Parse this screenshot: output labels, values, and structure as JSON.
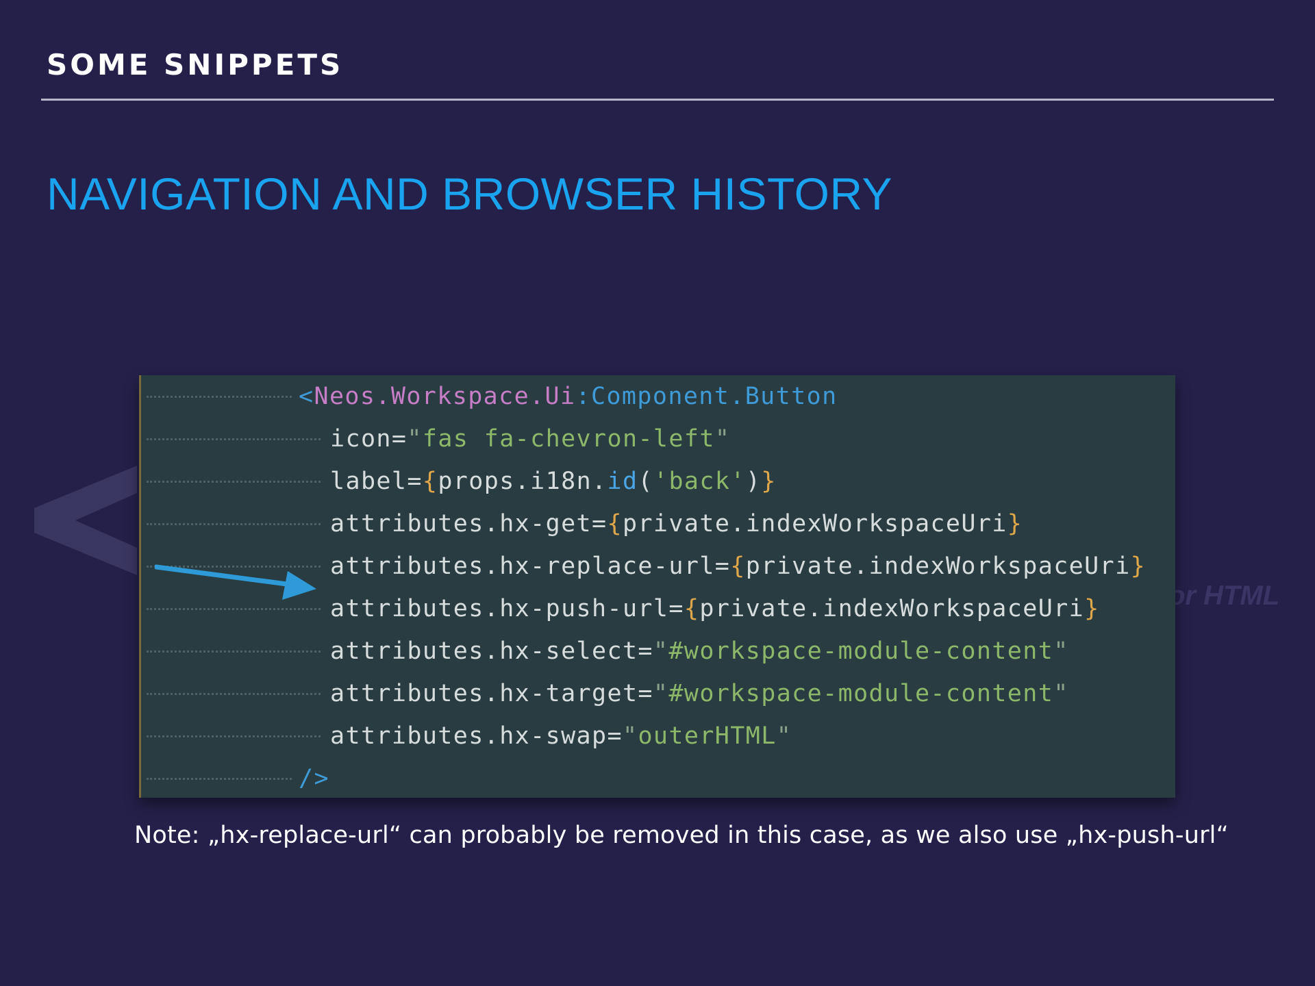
{
  "header": {
    "section_label": "SOME SNIPPETS",
    "title": "NAVIGATION AND BROWSER HISTORY"
  },
  "background": {
    "watermark_text": "or HTML"
  },
  "code": {
    "lines": [
      [
        {
          "t": "<",
          "c": "t-ns"
        },
        {
          "t": "Neos.Workspace.Ui",
          "c": "t-tag"
        },
        {
          "t": ":Component.Button",
          "c": "t-ns"
        }
      ],
      [
        {
          "t": "icon=",
          "c": "t-attr"
        },
        {
          "t": "\"",
          "c": "t-quote"
        },
        {
          "t": "fas fa-chevron-left",
          "c": "t-str"
        },
        {
          "t": "\"",
          "c": "t-quote"
        }
      ],
      [
        {
          "t": "label=",
          "c": "t-attr"
        },
        {
          "t": "{",
          "c": "t-brace"
        },
        {
          "t": "props.i18n.",
          "c": "t-attr"
        },
        {
          "t": "id",
          "c": "t-fn"
        },
        {
          "t": "(",
          "c": "t-punc"
        },
        {
          "t": "'back'",
          "c": "t-str"
        },
        {
          "t": ")",
          "c": "t-punc"
        },
        {
          "t": "}",
          "c": "t-brace"
        }
      ],
      [
        {
          "t": "attributes.hx-get=",
          "c": "t-attr"
        },
        {
          "t": "{",
          "c": "t-brace"
        },
        {
          "t": "private.indexWorkspaceUri",
          "c": "t-attr"
        },
        {
          "t": "}",
          "c": "t-brace"
        }
      ],
      [
        {
          "t": "attributes.hx-replace-url=",
          "c": "t-attr"
        },
        {
          "t": "{",
          "c": "t-brace"
        },
        {
          "t": "private.indexWorkspaceUri",
          "c": "t-attr"
        },
        {
          "t": "}",
          "c": "t-brace"
        }
      ],
      [
        {
          "t": "attributes.hx-push-url=",
          "c": "t-attr"
        },
        {
          "t": "{",
          "c": "t-brace"
        },
        {
          "t": "private.indexWorkspaceUri",
          "c": "t-attr"
        },
        {
          "t": "}",
          "c": "t-brace"
        }
      ],
      [
        {
          "t": "attributes.hx-select=",
          "c": "t-attr"
        },
        {
          "t": "\"",
          "c": "t-quote"
        },
        {
          "t": "#workspace-module-content",
          "c": "t-str"
        },
        {
          "t": "\"",
          "c": "t-quote"
        }
      ],
      [
        {
          "t": "attributes.hx-target=",
          "c": "t-attr"
        },
        {
          "t": "\"",
          "c": "t-quote"
        },
        {
          "t": "#workspace-module-content",
          "c": "t-str"
        },
        {
          "t": "\"",
          "c": "t-quote"
        }
      ],
      [
        {
          "t": "attributes.hx-swap=",
          "c": "t-attr"
        },
        {
          "t": "\"",
          "c": "t-quote"
        },
        {
          "t": "outerHTML",
          "c": "t-str"
        },
        {
          "t": "\"",
          "c": "t-quote"
        }
      ],
      [
        {
          "t": "/>",
          "c": "t-ns"
        }
      ]
    ]
  },
  "note": "Note: „hx-replace-url“ can probably be removed in this case, as we also use „hx-push-url“",
  "colors": {
    "background": "#25204a",
    "title": "#1aa3ee",
    "code_background": "#283c41",
    "arrow": "#2e9ad8"
  }
}
